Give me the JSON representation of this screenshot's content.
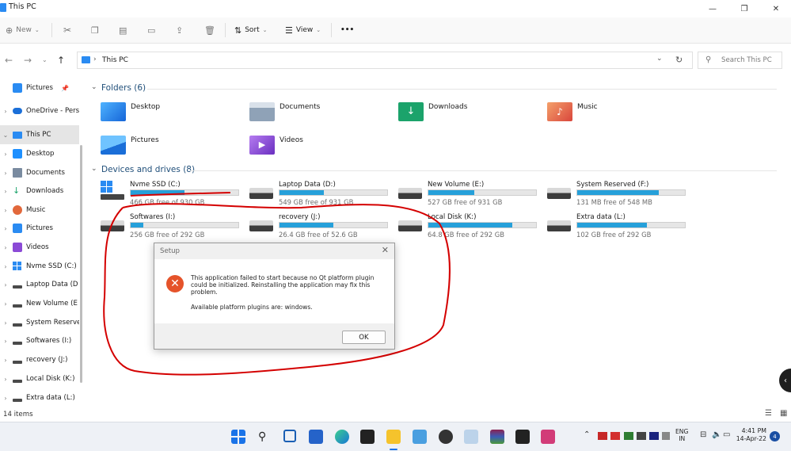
{
  "window": {
    "title": "This PC"
  },
  "toolbar": {
    "new_label": "New",
    "sort_label": "Sort",
    "view_label": "View",
    "more": "•••"
  },
  "address": {
    "location": "This PC",
    "search_placeholder": "Search This PC"
  },
  "sidebar": {
    "items": [
      {
        "label": "Pictures"
      },
      {
        "label": "OneDrive - Perso"
      },
      {
        "label": "This PC"
      },
      {
        "label": "Desktop"
      },
      {
        "label": "Documents"
      },
      {
        "label": "Downloads"
      },
      {
        "label": "Music"
      },
      {
        "label": "Pictures"
      },
      {
        "label": "Videos"
      },
      {
        "label": "Nvme SSD (C:)"
      },
      {
        "label": "Laptop Data (D"
      },
      {
        "label": "New Volume (E"
      },
      {
        "label": "System Reserve"
      },
      {
        "label": "Softwares (I:)"
      },
      {
        "label": "recovery (J:)"
      },
      {
        "label": "Local Disk (K:)"
      },
      {
        "label": "Extra data (L:)"
      }
    ]
  },
  "folders": {
    "heading": "Folders (6)",
    "items": [
      {
        "name": "Desktop",
        "color": "#1e90ff"
      },
      {
        "name": "Documents",
        "color": "#7a8ba0"
      },
      {
        "name": "Downloads",
        "color": "#1ba36b"
      },
      {
        "name": "Music",
        "color": "#e2683b"
      },
      {
        "name": "Pictures",
        "color": "#2a8bf2"
      },
      {
        "name": "Videos",
        "color": "#8b4ad6"
      }
    ]
  },
  "drives": {
    "heading": "Devices and drives (8)",
    "items": [
      {
        "name": "Nvme SSD (C:)",
        "free": "466 GB free of 930 GB",
        "used_fraction": 0.5
      },
      {
        "name": "Laptop Data (D:)",
        "free": "549 GB free of 931 GB",
        "used_fraction": 0.41
      },
      {
        "name": "New Volume (E:)",
        "free": "527 GB free of 931 GB",
        "used_fraction": 0.43
      },
      {
        "name": "System Reserved (F:)",
        "free": "131 MB free of 548 MB",
        "used_fraction": 0.76
      },
      {
        "name": "Softwares (I:)",
        "free": "256 GB free of 292 GB",
        "used_fraction": 0.12
      },
      {
        "name": "recovery (J:)",
        "free": "26.4 GB free of 52.6 GB",
        "used_fraction": 0.5
      },
      {
        "name": "Local Disk (K:)",
        "free": "64.8 GB free of 292 GB",
        "used_fraction": 0.78
      },
      {
        "name": "Extra data (L:)",
        "free": "102 GB free of 292 GB",
        "used_fraction": 0.65
      }
    ]
  },
  "dialog": {
    "title": "Setup",
    "message": "This application failed to start because no Qt platform plugin could be initialized. Reinstalling the application may fix this problem.",
    "detail": "Available platform plugins are: windows.",
    "ok_label": "OK"
  },
  "status": {
    "items_count": "14 items"
  },
  "taskbar": {
    "lang": "ENG",
    "region": "IN",
    "time": "4:41 PM",
    "date": "14-Apr-22",
    "notifications": "4"
  },
  "colors": {
    "drive_fill": "#26a0da",
    "annotation": "#d40000"
  }
}
